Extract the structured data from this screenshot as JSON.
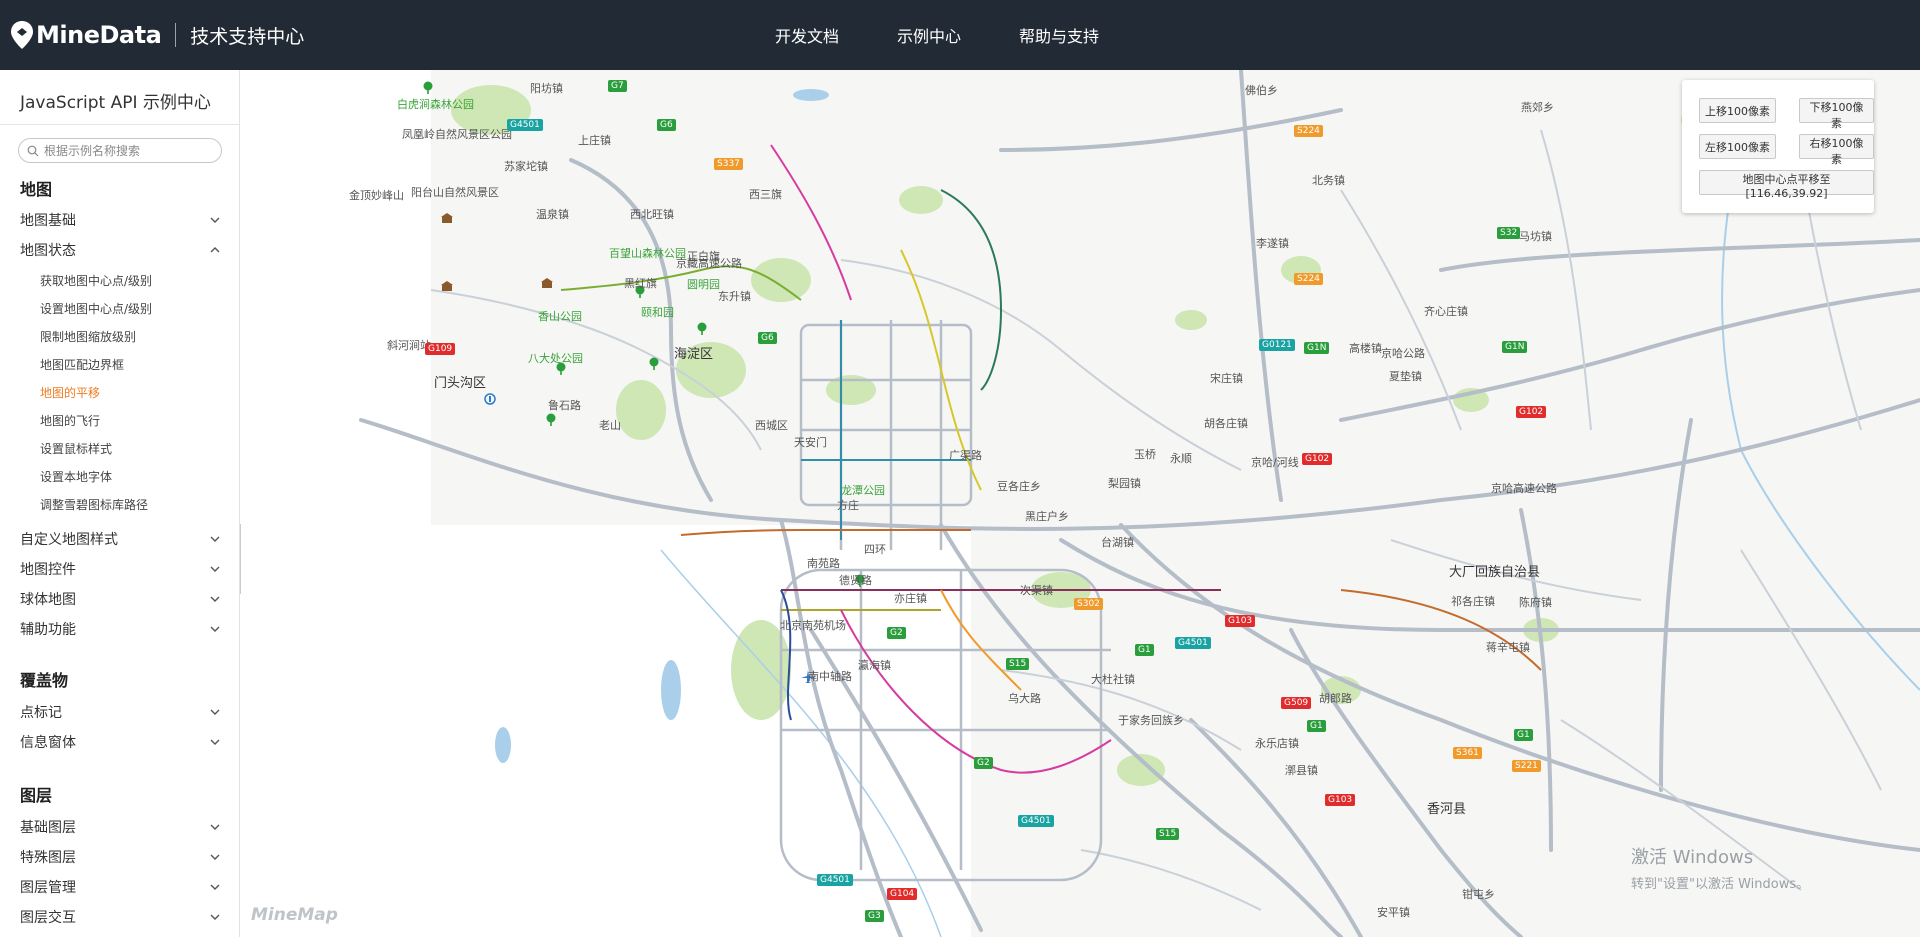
{
  "header": {
    "logo_text": "MineData",
    "subtitle": "技术支持中心",
    "nav": [
      "开发文档",
      "示例中心",
      "帮助与支持"
    ]
  },
  "sidebar": {
    "title": "JavaScript API 示例中心",
    "search_placeholder": "根据示例名称搜索",
    "sections": [
      {
        "title": "地图",
        "categories": [
          {
            "label": "地图基础",
            "expanded": false
          },
          {
            "label": "地图状态",
            "expanded": true,
            "items": [
              "获取地图中心点/级别",
              "设置地图中心点/级别",
              "限制地图缩放级别",
              "地图匹配边界框",
              "地图的平移",
              "地图的飞行",
              "设置鼠标样式",
              "设置本地字体",
              "调整雪碧图标库路径"
            ],
            "active_item": "地图的平移"
          },
          {
            "label": "自定义地图样式",
            "expanded": false
          },
          {
            "label": "地图控件",
            "expanded": false
          },
          {
            "label": "球体地图",
            "expanded": false
          },
          {
            "label": "辅助功能",
            "expanded": false
          }
        ]
      },
      {
        "title": "覆盖物",
        "categories": [
          {
            "label": "点标记",
            "expanded": false
          },
          {
            "label": "信息窗体",
            "expanded": false
          }
        ]
      },
      {
        "title": "图层",
        "categories": [
          {
            "label": "基础图层",
            "expanded": false
          },
          {
            "label": "特殊图层",
            "expanded": false
          },
          {
            "label": "图层管理",
            "expanded": false
          },
          {
            "label": "图层交互",
            "expanded": false
          }
        ]
      }
    ]
  },
  "controls": {
    "up": "上移100像素",
    "down": "下移100像素",
    "left": "左移100像素",
    "right": "右移100像素",
    "center": "地图中心点平移至[116.46,39.92]"
  },
  "map": {
    "watermark": "MineMap",
    "places": [
      "白虎涧森林公园",
      "阳坊镇",
      "凤凰岭自然风景区公园",
      "上庄镇",
      "苏家坨镇",
      "金顶妙峰山",
      "阳台山自然风景区",
      "温泉镇",
      "西北旺镇",
      "西三旗",
      "百望山森林公园",
      "正白旗",
      "黑红旗",
      "圆明园",
      "东升镇",
      "香山公园",
      "颐和园",
      "海淀区",
      "八大处公园",
      "斜河涧站",
      "门头沟区",
      "鲁石路",
      "西城区",
      "老山",
      "天安门",
      "广渠路",
      "龙潭公园",
      "方庄",
      "豆各庄乡",
      "黑庄户乡",
      "四环",
      "南苑路",
      "德贤路",
      "亦庄镇",
      "北京南苑机场",
      "次渠镇",
      "瀛海镇",
      "南中轴路",
      "大杜社镇",
      "于家务回族乡",
      "永乐店镇",
      "乌大路",
      "台湖镇",
      "梨园镇",
      "玉桥",
      "永顺",
      "宋庄镇",
      "胡各庄镇",
      "京哈公路",
      "夏垫镇",
      "齐心庄镇",
      "高楼镇",
      "北务镇",
      "李遂镇",
      "马坊镇",
      "佛伯乡",
      "燕郊乡",
      "大厂回族自治县",
      "祁各庄镇",
      "陈府镇",
      "蒋辛屯镇",
      "漷县镇",
      "胡郎路",
      "香河县",
      "安平镇",
      "钳屯乡",
      "京哈高速公路",
      "京哈/河线",
      "京藏高速公路"
    ],
    "shields": [
      "G7",
      "G6",
      "G4501",
      "S337",
      "G6",
      "G109",
      "G2",
      "S15",
      "G1",
      "G4501",
      "S302",
      "G103",
      "S32",
      "S224",
      "S224",
      "G0121",
      "G1N",
      "G1N",
      "G102",
      "G102",
      "G509",
      "G1",
      "G1",
      "S361",
      "S221",
      "G103",
      "G4501",
      "S15",
      "G4501",
      "G104",
      "G3",
      "G2"
    ]
  },
  "overlay": {
    "win_line1": "激活 Windows",
    "win_line2": "转到\"设置\"以激活 Windows。"
  }
}
